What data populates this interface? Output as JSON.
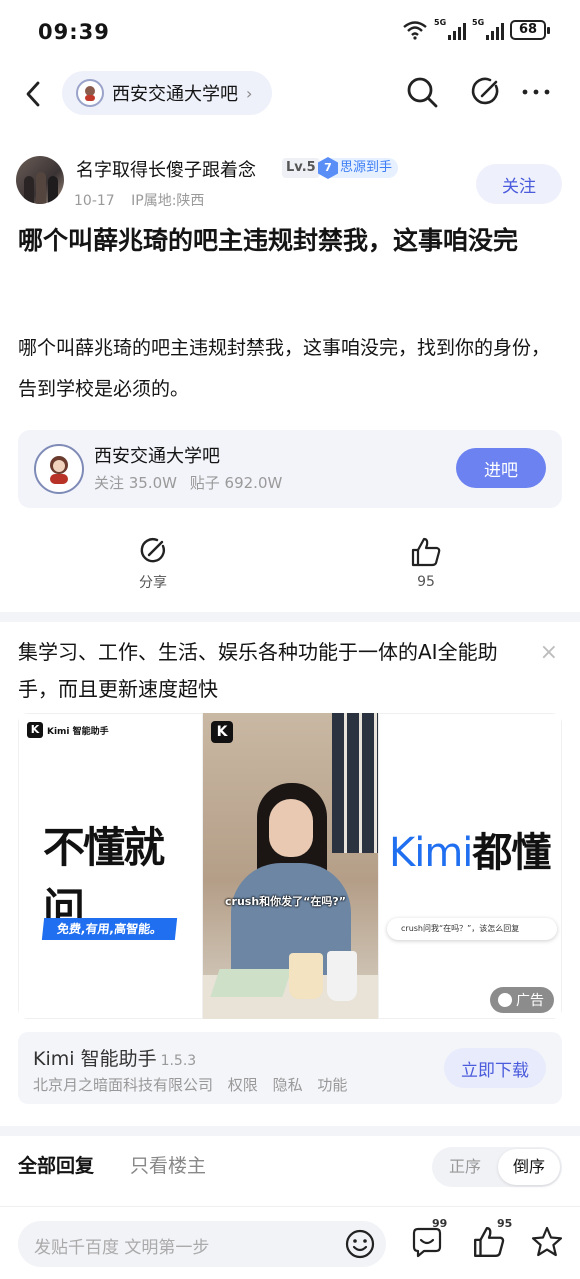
{
  "status_bar": {
    "time": "09:39",
    "battery": "68",
    "signal1_label": "5G",
    "signal2_label": "5G"
  },
  "nav": {
    "forum_name": "西安交通大学吧"
  },
  "author": {
    "name": "名字取得长傻子跟着念",
    "level": "Lv.5",
    "honor_level": "7",
    "honor": "思源到手",
    "date": "10-17",
    "ip": "IP属地:陕西",
    "follow_label": "关注"
  },
  "post": {
    "title": "哪个叫薛兆琦的吧主违规封禁我，这事咱没完",
    "body": "哪个叫薛兆琦的吧主违规封禁我，这事咱没完，找到你的身份，告到学校是必须的。"
  },
  "forum_card": {
    "name": "西安交通大学吧",
    "followers": "关注 35.0W",
    "posts": "贴子 692.0W",
    "enter_label": "进吧"
  },
  "actions": {
    "share_label": "分享",
    "like_count": "95"
  },
  "ad": {
    "text": "集学习、工作、生活、娱乐各种功能于一体的AI全能助手，而且更新速度超快",
    "close": "×",
    "left_brand": "Kimi 智能助手",
    "left_headline": "不懂就问",
    "left_tag": "免费,有用,高智能。",
    "center_caption": "crush和你发了“在吗?”",
    "right_headline_en": "Kimi",
    "right_headline_zh": "都懂",
    "right_input": "crush问我“在吗？”，该怎么回复",
    "ad_badge": "广告",
    "app_name": "Kimi 智能助手",
    "app_version": "1.5.3",
    "app_company": "北京月之暗面科技有限公司",
    "app_permissions": "权限",
    "app_privacy": "隐私",
    "app_features": "功能",
    "download_label": "立即下载"
  },
  "replies": {
    "tab_all": "全部回复",
    "tab_owner": "只看楼主",
    "sort_asc": "正序",
    "sort_desc": "倒序"
  },
  "bottom_bar": {
    "placeholder": "发贴千百度 文明第一步",
    "comment_count": "99",
    "like_count": "95"
  },
  "colors": {
    "accent": "#4a5bdc",
    "enter_button": "#6b82f0",
    "honor_blue": "#3d7ef5"
  }
}
